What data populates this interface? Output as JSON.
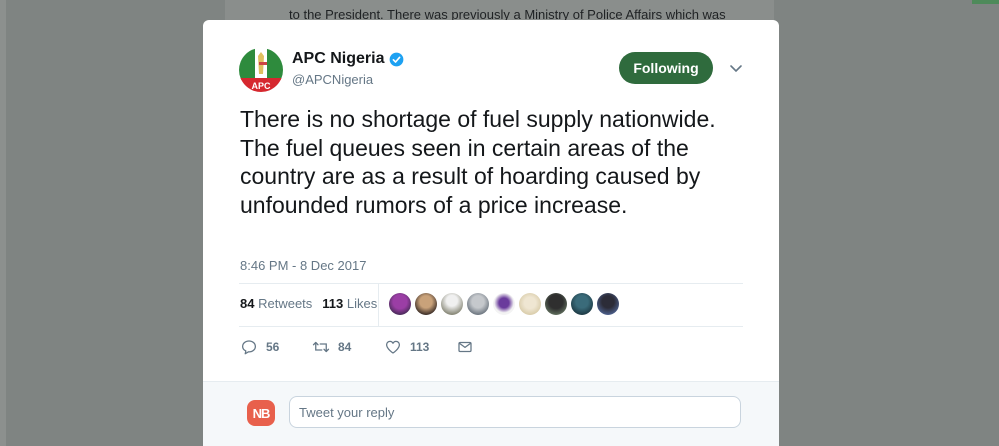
{
  "background": {
    "snippet": "to the President. There was previously a Ministry of Police Affairs which was"
  },
  "tweet": {
    "author_name": "APC Nigeria",
    "author_handle": "@APCNigeria",
    "avatar_label": "APC",
    "follow_label": "Following",
    "text": "There is no shortage of fuel supply nationwide. The fuel queues seen in certain areas of the country are as a result of hoarding caused by unfounded rumors of a price increase.",
    "timestamp": "8:46 PM - 8 Dec 2017",
    "retweets_count": "84",
    "retweets_label": "Retweets",
    "likes_count": "113",
    "likes_label": "Likes",
    "actions": {
      "replies": "56",
      "retweets": "84",
      "likes": "113"
    },
    "reply_placeholder": "Tweet your reply",
    "viewer_avatar_label": "NB"
  },
  "colors": {
    "follow_button": "#2f6b3d",
    "verified_badge": "#1da1f2",
    "secondary_text": "#657786",
    "primary_text": "#14171a"
  },
  "icons": [
    "verified-badge-icon",
    "chevron-down-icon",
    "reply-icon",
    "retweet-icon",
    "like-icon",
    "direct-message-icon"
  ]
}
